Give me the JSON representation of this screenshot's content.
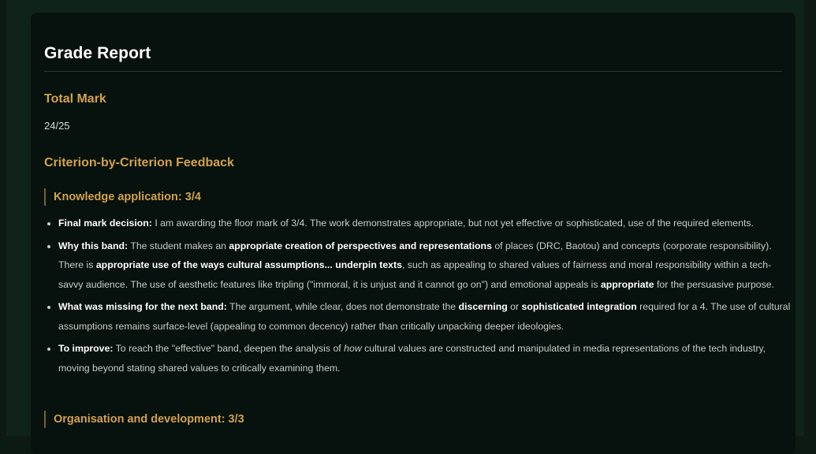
{
  "report": {
    "title": "Grade Report",
    "total_heading": "Total Mark",
    "total_value": "24/25",
    "feedback_heading": "Criterion-by-Criterion Feedback"
  },
  "criteria": [
    {
      "heading": "Knowledge application: 3/4",
      "points": [
        {
          "label": "Final mark decision:",
          "t1": " I am awarding the floor mark of 3/4. The work demonstrates appropriate, but not yet effective or sophisticated, use of the required elements."
        },
        {
          "label": "Why this band:",
          "t1": " The student makes an ",
          "b1": "appropriate creation of perspectives and representations",
          "t2": " of places (DRC, Baotou) and concepts (corporate responsibility). There is ",
          "b2": "appropriate use of the ways cultural assumptions... underpin texts",
          "t3": ", such as appealing to shared values of fairness and moral responsibility within a tech-savvy audience. The use of aesthetic features like tripling (\"immoral, it is unjust and it cannot go on\") and emotional appeals is ",
          "b3": "appropriate",
          "t4": " for the persuasive purpose."
        },
        {
          "label": "What was missing for the next band:",
          "t1": " The argument, while clear, does not demonstrate the ",
          "b1": "discerning",
          "t2": " or ",
          "b2": "sophisticated integration",
          "t3": " required for a 4. The use of cultural assumptions remains surface-level (appealing to common decency) rather than critically unpacking deeper ideologies."
        },
        {
          "label": "To improve:",
          "t1": " To reach the \"effective\" band, deepen the analysis of ",
          "i1": "how",
          "t2": " cultural values are constructed and manipulated in media representations of the tech industry, moving beyond stating shared values to critically examining them."
        }
      ]
    },
    {
      "heading": "Organisation and development: 3/3"
    }
  ]
}
